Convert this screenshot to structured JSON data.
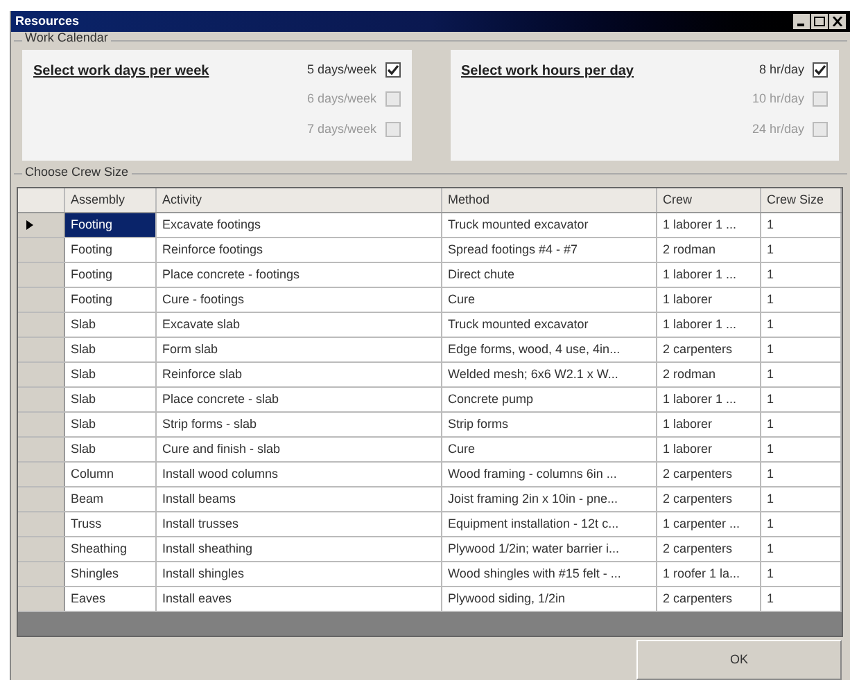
{
  "window": {
    "title": "Resources"
  },
  "work_calendar": {
    "title": "Work Calendar",
    "groups": [
      {
        "heading": "Select work days per week",
        "options": [
          {
            "label": "5 days/week",
            "checked": true,
            "disabled": false
          },
          {
            "label": "6 days/week",
            "checked": false,
            "disabled": true
          },
          {
            "label": "7 days/week",
            "checked": false,
            "disabled": true
          }
        ]
      },
      {
        "heading": "Select work hours per day",
        "options": [
          {
            "label": "8 hr/day",
            "checked": true,
            "disabled": false
          },
          {
            "label": "10 hr/day",
            "checked": false,
            "disabled": true
          },
          {
            "label": "24 hr/day",
            "checked": false,
            "disabled": true
          }
        ]
      }
    ]
  },
  "crew_size": {
    "title": "Choose Crew Size",
    "table": {
      "columns": [
        "Assembly",
        "Activity",
        "Method",
        "Crew",
        "Crew Size"
      ],
      "rows": [
        {
          "selected": true,
          "cells": [
            "Footing",
            "Excavate footings",
            "Truck mounted excavator",
            "1 laborer 1 ...",
            "1"
          ]
        },
        {
          "selected": false,
          "cells": [
            "Footing",
            "Reinforce footings",
            "Spread footings #4 - #7",
            "2 rodman",
            "1"
          ]
        },
        {
          "selected": false,
          "cells": [
            "Footing",
            "Place concrete - footings",
            "Direct chute",
            "1 laborer 1 ...",
            "1"
          ]
        },
        {
          "selected": false,
          "cells": [
            "Footing",
            "Cure - footings",
            "Cure",
            "1 laborer",
            "1"
          ]
        },
        {
          "selected": false,
          "cells": [
            "Slab",
            "Excavate slab",
            "Truck mounted excavator",
            "1 laborer 1 ...",
            "1"
          ]
        },
        {
          "selected": false,
          "cells": [
            "Slab",
            "Form slab",
            "Edge forms, wood, 4 use, 4in...",
            "2 carpenters",
            "1"
          ]
        },
        {
          "selected": false,
          "cells": [
            "Slab",
            "Reinforce slab",
            "Welded mesh; 6x6 W2.1 x W...",
            "2 rodman",
            "1"
          ]
        },
        {
          "selected": false,
          "cells": [
            "Slab",
            "Place concrete - slab",
            "Concrete pump",
            "1 laborer 1 ...",
            "1"
          ]
        },
        {
          "selected": false,
          "cells": [
            "Slab",
            "Strip forms - slab",
            "Strip forms",
            "1 laborer",
            "1"
          ]
        },
        {
          "selected": false,
          "cells": [
            "Slab",
            "Cure and finish - slab",
            "Cure",
            "1 laborer",
            "1"
          ]
        },
        {
          "selected": false,
          "cells": [
            "Column",
            "Install wood columns",
            "Wood framing - columns 6in ...",
            "2 carpenters",
            "1"
          ]
        },
        {
          "selected": false,
          "cells": [
            "Beam",
            "Install beams",
            "Joist framing 2in x 10in - pne...",
            "2 carpenters",
            "1"
          ]
        },
        {
          "selected": false,
          "cells": [
            "Truss",
            "Install trusses",
            "Equipment installation - 12t c...",
            "1 carpenter ...",
            "1"
          ]
        },
        {
          "selected": false,
          "cells": [
            "Sheathing",
            "Install sheathing",
            "Plywood 1/2in; water barrier i...",
            "2 carpenters",
            "1"
          ]
        },
        {
          "selected": false,
          "cells": [
            "Shingles",
            "Install shingles",
            "Wood shingles with #15 felt - ...",
            "1 roofer 1 la...",
            "1"
          ]
        },
        {
          "selected": false,
          "cells": [
            "Eaves",
            "Install eaves",
            "Plywood siding, 1/2in",
            "2 carpenters",
            "1"
          ]
        }
      ]
    }
  },
  "buttons": [
    "OK"
  ]
}
